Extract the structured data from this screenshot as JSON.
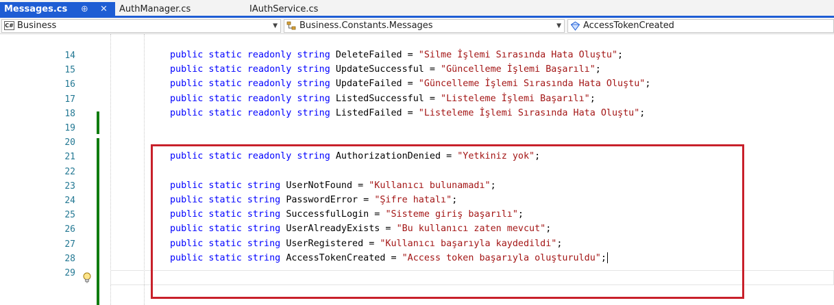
{
  "tabs": [
    {
      "label": "Messages.cs",
      "pin": "⊕",
      "close": "✕",
      "active": true
    },
    {
      "label": "AuthManager.cs",
      "active": false
    },
    {
      "label": "IAuthService.cs",
      "active": false
    }
  ],
  "nav": {
    "project": {
      "badge": "C#",
      "label": "Business"
    },
    "type": {
      "label": "Business.Constants.Messages"
    },
    "member": {
      "label": "AccessTokenCreated"
    },
    "dropdown_glyph": "▼"
  },
  "lines": [
    {
      "n": "14",
      "id": "DeleteFailed",
      "text": "\"Silme İşlemi Sırasında Hata Oluştu\""
    },
    {
      "n": "15",
      "id": "UpdateSuccessful",
      "text": "\"Güncelleme İşlemi Başarılı\""
    },
    {
      "n": "16",
      "id": "UpdateFailed",
      "text": "\"Güncelleme İşlemi Sırasında Hata Oluştu\""
    },
    {
      "n": "17",
      "id": "ListedSuccessful",
      "text": "\"Listeleme İşlemi Başarılı\""
    },
    {
      "n": "18",
      "id": "ListedFailed",
      "text": "\"Listeleme İşlemi Sırasında Hata Oluştu\""
    },
    {
      "n": "19"
    },
    {
      "n": "20"
    },
    {
      "n": "21",
      "id": "AuthorizationDenied",
      "text": "\"Yetkiniz yok\""
    },
    {
      "n": "22"
    },
    {
      "n": "23",
      "id": "UserNotFound",
      "text": "\"Kullanıcı bulunamadı\""
    },
    {
      "n": "24",
      "id": "PasswordError",
      "text": "\"Şifre hatalı\""
    },
    {
      "n": "25",
      "id": "SuccessfulLogin",
      "text": "\"Sisteme giriş başarılı\""
    },
    {
      "n": "26",
      "id": "UserAlreadyExists",
      "text": "\"Bu kullanıcı zaten mevcut\""
    },
    {
      "n": "27",
      "id": "UserRegistered",
      "text": "\"Kullanıcı başarıyla kaydedildi\""
    },
    {
      "n": "28",
      "id": "AccessTokenCreated",
      "text": "\"Access token başarıyla oluşturuldu\""
    },
    {
      "n": "29"
    }
  ],
  "keywords": {
    "readonly_decl": "public static readonly string",
    "plain_decl": "public static string",
    "assign": " = ",
    "terminator": ";"
  },
  "colors": {
    "tab_active": "#1e5dd4",
    "keyword": "#0000ff",
    "string": "#a31515",
    "line_number": "#237893",
    "change_bar": "#107c10",
    "highlight_box": "#c8202a"
  }
}
